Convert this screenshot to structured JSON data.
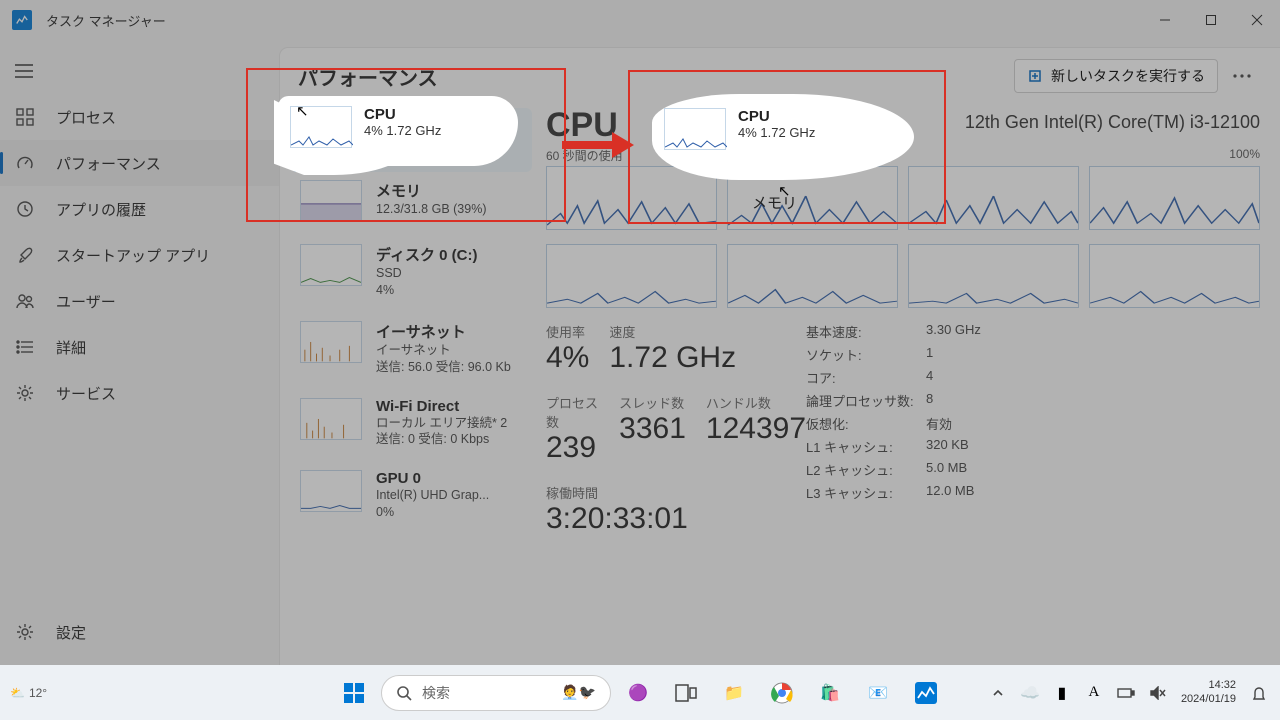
{
  "window": {
    "title": "タスク マネージャー"
  },
  "nav": {
    "items": [
      {
        "label": "プロセス"
      },
      {
        "label": "パフォーマンス"
      },
      {
        "label": "アプリの履歴"
      },
      {
        "label": "スタートアップ アプリ"
      },
      {
        "label": "ユーザー"
      },
      {
        "label": "詳細"
      },
      {
        "label": "サービス"
      }
    ],
    "settings_label": "設定"
  },
  "main": {
    "title": "パフォーマンス",
    "new_task_label": "新しいタスクを実行する",
    "perf_items": [
      {
        "title": "CPU",
        "sub": "4%  1.72 GHz"
      },
      {
        "title": "メモリ",
        "sub": "12.3/31.8 GB (39%)"
      },
      {
        "title": "ディスク 0 (C:)",
        "sub": "SSD\n4%"
      },
      {
        "title": "イーサネット",
        "sub": "イーサネット\n送信: 56.0 受信: 96.0 Kb"
      },
      {
        "title": "Wi-Fi Direct",
        "sub": "ローカル エリア接続* 2\n送信: 0 受信: 0 Kbps"
      },
      {
        "title": "GPU 0",
        "sub": "Intel(R) UHD Grap...\n0%"
      }
    ]
  },
  "detail": {
    "title": "CPU",
    "model": "12th Gen Intel(R) Core(TM) i3-12100",
    "graph_left_label": "60 秒間の使用",
    "graph_top_right": "100%",
    "stats_big": {
      "usage_label": "使用率",
      "usage_value": "4%",
      "speed_label": "速度",
      "speed_value": "1.72 GHz",
      "processes_label": "プロセス数",
      "processes_value": "239",
      "threads_label": "スレッド数",
      "threads_value": "3361",
      "handles_label": "ハンドル数",
      "handles_value": "124397",
      "uptime_label": "稼働時間",
      "uptime_value": "3:20:33:01"
    },
    "stats_kv": [
      {
        "k": "基本速度:",
        "v": "3.30 GHz"
      },
      {
        "k": "ソケット:",
        "v": "1"
      },
      {
        "k": "コア:",
        "v": "4"
      },
      {
        "k": "論理プロセッサ数:",
        "v": "8"
      },
      {
        "k": "仮想化:",
        "v": "有効"
      },
      {
        "k": "L1 キャッシュ:",
        "v": "320 KB"
      },
      {
        "k": "L2 キャッシュ:",
        "v": "5.0 MB"
      },
      {
        "k": "L3 キャッシュ:",
        "v": "12.0 MB"
      }
    ]
  },
  "highlight": {
    "blob1": {
      "title": "CPU",
      "sub": "4%  1.72 GHz"
    },
    "blob2": {
      "title": "CPU",
      "sub": "4%  1.72 GHz"
    },
    "memory_label": "メモリ"
  },
  "taskbar": {
    "weather_temp": "12°",
    "search_placeholder": "検索",
    "clock_time": "14:32",
    "clock_date": "2024/01/19"
  }
}
